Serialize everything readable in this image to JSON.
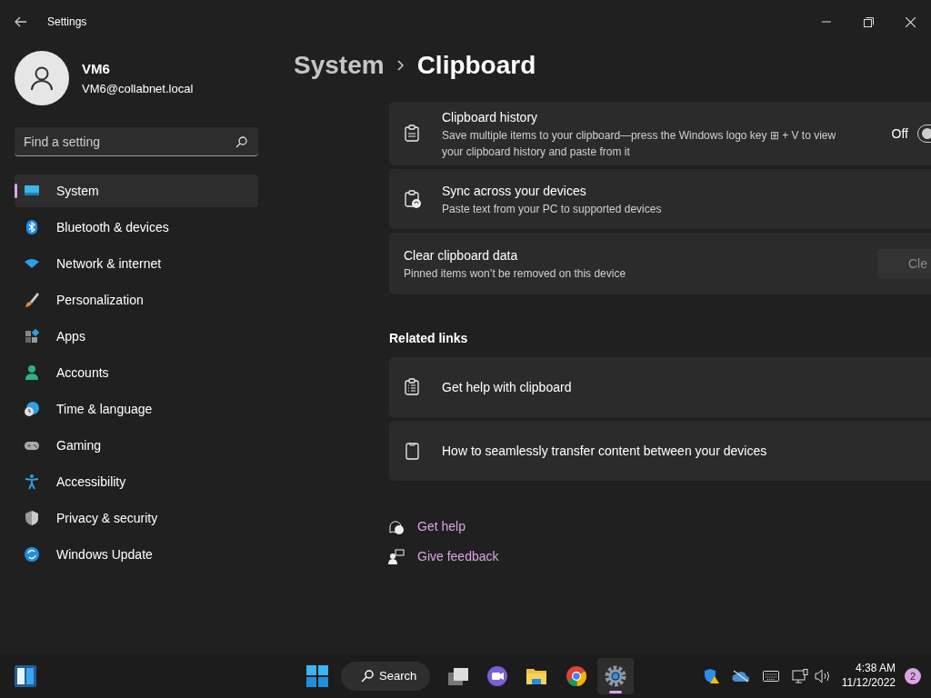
{
  "window": {
    "title": "Settings"
  },
  "profile": {
    "name": "VM6",
    "email": "VM6@collabnet.local"
  },
  "search": {
    "placeholder": "Find a setting"
  },
  "sidebar": {
    "items": [
      {
        "label": "System",
        "selected": true
      },
      {
        "label": "Bluetooth & devices",
        "selected": false
      },
      {
        "label": "Network & internet",
        "selected": false
      },
      {
        "label": "Personalization",
        "selected": false
      },
      {
        "label": "Apps",
        "selected": false
      },
      {
        "label": "Accounts",
        "selected": false
      },
      {
        "label": "Time & language",
        "selected": false
      },
      {
        "label": "Gaming",
        "selected": false
      },
      {
        "label": "Accessibility",
        "selected": false
      },
      {
        "label": "Privacy & security",
        "selected": false
      },
      {
        "label": "Windows Update",
        "selected": false
      }
    ]
  },
  "breadcrumb": [
    "System",
    "Clipboard"
  ],
  "settings": [
    {
      "kind": "toggle",
      "title": "Clipboard history",
      "description": "Save multiple items to your clipboard—press the Windows logo key ⊞ + V to view your clipboard history and paste from it",
      "status": "Off",
      "on": false
    },
    {
      "kind": "info",
      "title": "Sync across your devices",
      "description": "Paste text from your PC to supported devices"
    },
    {
      "kind": "button",
      "title": "Clear clipboard data",
      "description": "Pinned items won’t be removed on this device",
      "button": "Cle"
    }
  ],
  "related_links": {
    "heading": "Related links",
    "items": [
      "Get help with clipboard",
      "How to seamlessly transfer content between your devices"
    ]
  },
  "footer_links": [
    "Get help",
    "Give feedback"
  ],
  "taskbar": {
    "search": "Search",
    "apps": [
      {
        "selected": false
      },
      {
        "selected": false
      },
      {
        "selected": false
      },
      {
        "selected": false
      },
      {
        "selected": true
      }
    ],
    "time": "4:38 AM",
    "date": "11/12/2022",
    "notifications": "2"
  }
}
